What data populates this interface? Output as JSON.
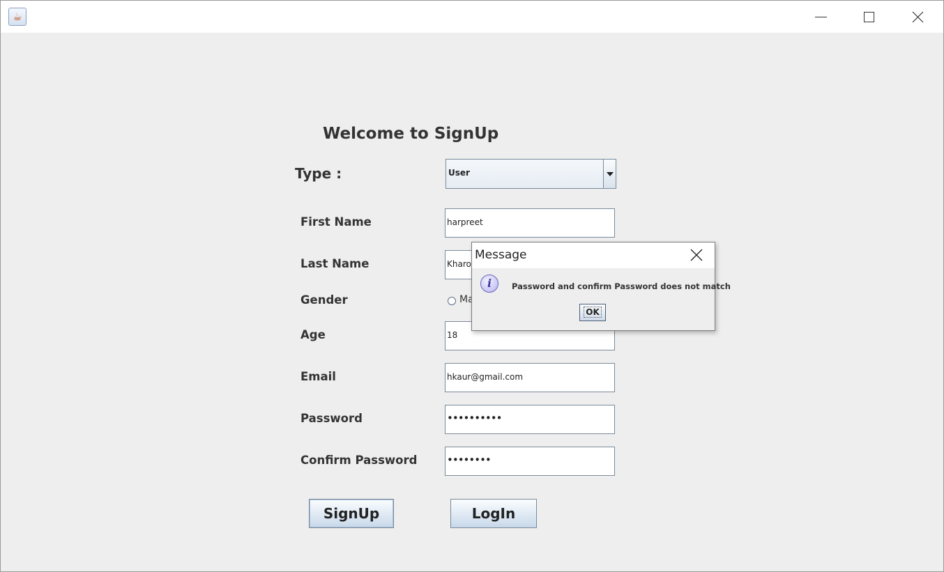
{
  "titlebar": {
    "app_icon": "java-cup-icon",
    "controls": [
      "minimize-icon",
      "maximize-icon",
      "close-icon"
    ]
  },
  "form": {
    "title": "Welcome to SignUp",
    "type_label": "Type :",
    "type_value": "User",
    "first_name_label": "First Name",
    "first_name_value": "harpreet",
    "last_name_label": "Last Name",
    "last_name_value": "Kharour",
    "gender_label": "Gender",
    "gender_option_visible": "Ma",
    "age_label": "Age",
    "age_value": "18",
    "email_label": "Email",
    "email_value": "hkaur@gmail.com",
    "password_label": "Password",
    "password_value": "••••••••••",
    "confirm_password_label": "Confirm Password",
    "confirm_password_value": "••••••••",
    "signup_button": "SignUp",
    "login_button": "LogIn"
  },
  "dialog": {
    "title": "Message",
    "icon": "info-icon",
    "message": "Password and confirm Password does not match",
    "ok_button": "OK"
  }
}
